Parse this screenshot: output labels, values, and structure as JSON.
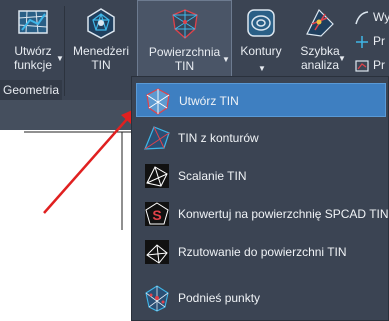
{
  "ribbon": {
    "group_label": "Geometria",
    "buttons": [
      {
        "label_line1": "Utwórz",
        "label_line2": "funkcje"
      },
      {
        "label_line1": "Menedżeri",
        "label_line2": "TIN"
      },
      {
        "label_line1": "Powierzchnia",
        "label_line2": "TIN"
      },
      {
        "label_line1": "Kontury",
        "label_line2": ""
      },
      {
        "label_line1": "Szybka",
        "label_line2": "analiza"
      }
    ],
    "small_items": [
      "Wy",
      "Pr",
      "Pr"
    ]
  },
  "menu": {
    "items": [
      {
        "label": "Utwórz TIN",
        "icon": "create-tin-icon",
        "highlighted": true
      },
      {
        "label": "TIN z konturów",
        "icon": "tin-from-contours-icon"
      },
      {
        "label": "Scalanie TIN",
        "icon": "merge-tin-icon"
      },
      {
        "label": "Konwertuj na powierzchnię SPCAD TIN",
        "icon": "convert-spcad-icon"
      },
      {
        "label": "Rzutowanie do powierzchni TIN",
        "icon": "project-to-tin-icon"
      },
      {
        "label": "Podnieś punkty",
        "icon": "raise-points-icon"
      }
    ]
  },
  "colors": {
    "ribbon_bg": "#3b4453",
    "highlight": "#3e7fc1",
    "arrow": "#e02020",
    "icon_cyan": "#3fb6e8",
    "icon_red": "#e0424a"
  }
}
